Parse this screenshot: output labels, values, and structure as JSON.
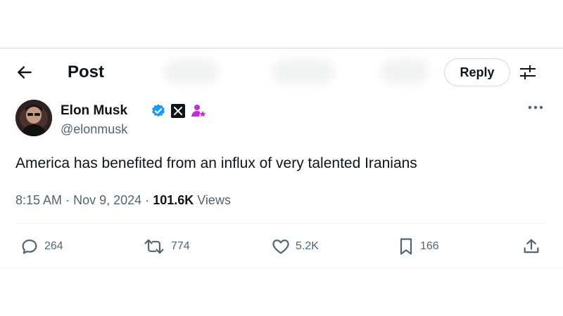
{
  "header": {
    "title": "Post",
    "reply_label": "Reply"
  },
  "author": {
    "display_name": "Elon Musk",
    "handle": "@elonmusk"
  },
  "post": {
    "text": "America has benefited from an influx of very talented Iranians",
    "time": "8:15 AM",
    "separator": "·",
    "date": "Nov 9, 2024",
    "views_count": "101.6K",
    "views_label": "Views"
  },
  "actions": {
    "replies": "264",
    "reposts": "774",
    "likes": "5.2K",
    "bookmarks": "166"
  },
  "icons": {
    "back": "arrow-left-icon",
    "settings": "sliders-icon",
    "verified": "verified-badge-icon",
    "affiliate": "x-logo-icon",
    "subscriber": "person-star-icon",
    "more": "more-dots-icon",
    "reply": "reply-bubble-icon",
    "repost": "repost-icon",
    "like": "heart-icon",
    "bookmark": "bookmark-icon",
    "share": "share-icon"
  },
  "colors": {
    "text_primary": "#0f1419",
    "text_secondary": "#536471",
    "verified_blue": "#1d9bf0",
    "subscriber_purple": "#c12fd6",
    "border": "#cfd9de"
  }
}
